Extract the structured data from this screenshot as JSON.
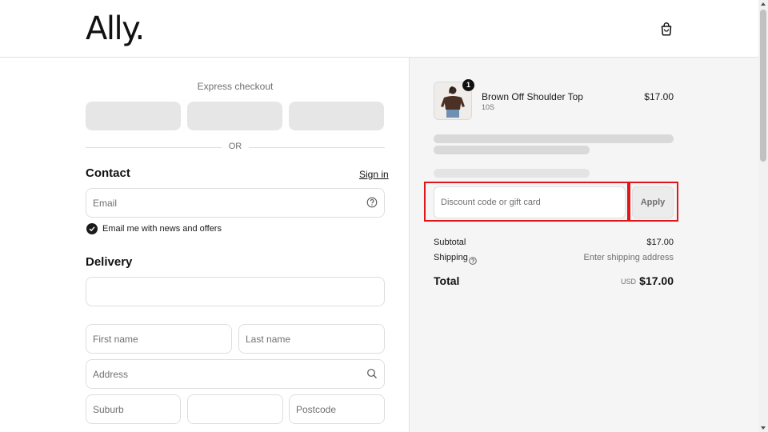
{
  "header": {
    "logo": "Ally.",
    "cart_icon": "shopping-bag-icon"
  },
  "checkout": {
    "express_label": "Express checkout",
    "or_label": "OR",
    "contact": {
      "title": "Contact",
      "sign_in": "Sign in",
      "email_placeholder": "Email",
      "email_help_icon": "question-circle-icon",
      "newsletter_label": "Email me with news and offers",
      "newsletter_checked": true
    },
    "delivery": {
      "title": "Delivery",
      "country_value": "",
      "first_name_placeholder": "First name",
      "last_name_placeholder": "Last name",
      "address_placeholder": "Address",
      "address_icon": "search-icon",
      "suburb_placeholder": "Suburb",
      "state_value": "",
      "postcode_placeholder": "Postcode"
    }
  },
  "summary": {
    "item": {
      "name": "Brown Off Shoulder Top",
      "variant": "10S",
      "price": "$17.00",
      "quantity": "1"
    },
    "discount_placeholder": "Discount code or gift card",
    "apply_label": "Apply",
    "subtotal_label": "Subtotal",
    "subtotal_value": "$17.00",
    "shipping_label": "Shipping",
    "shipping_value": "Enter shipping address",
    "total_label": "Total",
    "total_currency": "USD",
    "total_value": "$17.00"
  },
  "colors": {
    "highlight": "#e0161b",
    "summary_bg": "#f5f5f5",
    "skeleton": "#d9d9d9"
  }
}
